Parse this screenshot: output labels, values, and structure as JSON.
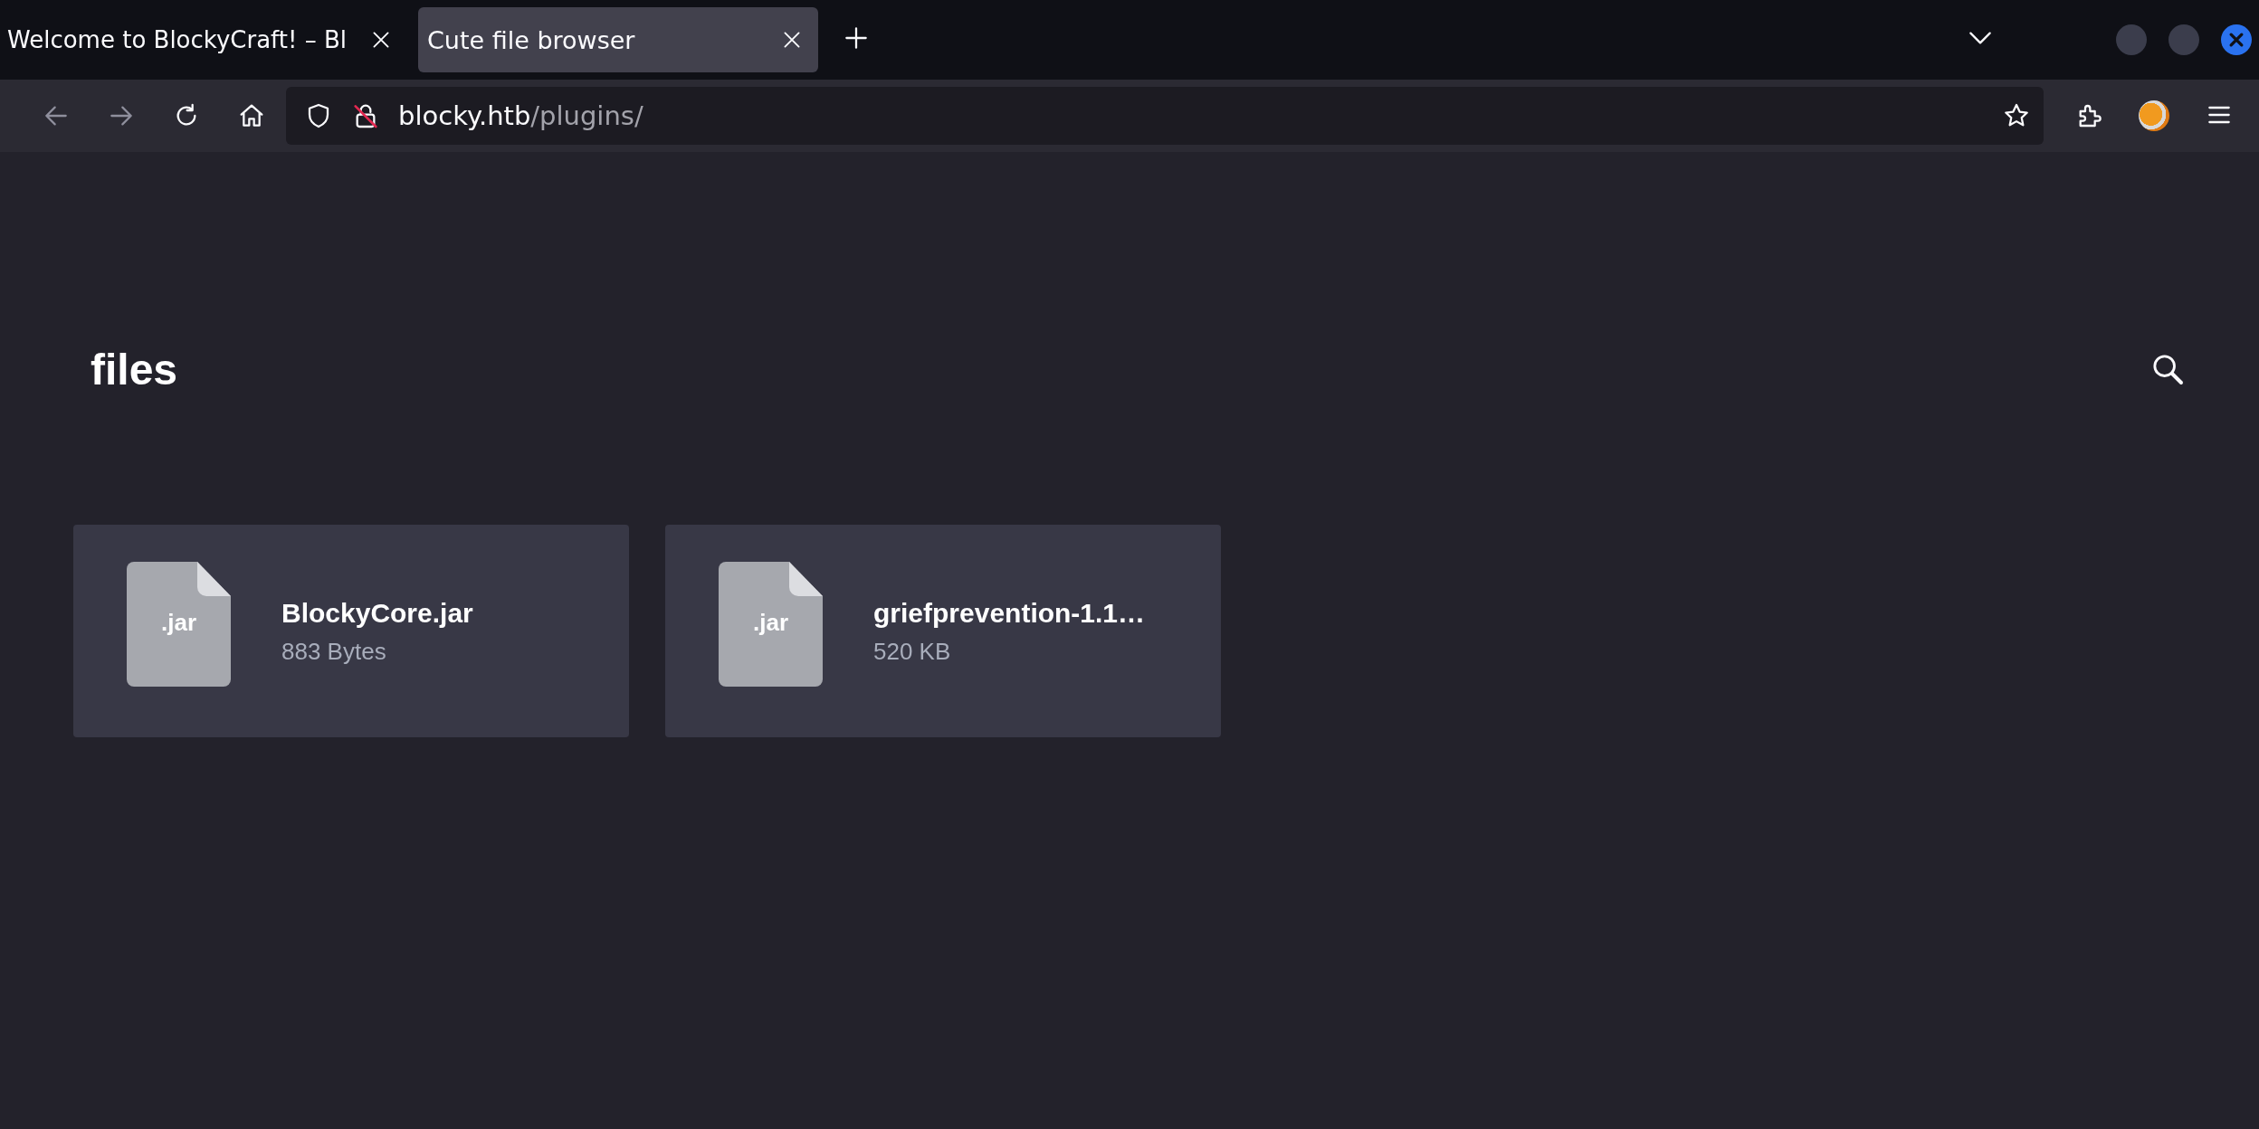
{
  "browser": {
    "tabs": [
      {
        "title": "Welcome to BlockyCraft! – Bl",
        "selected": false
      },
      {
        "title": "Cute file browser",
        "selected": true
      }
    ],
    "address": {
      "host": "blocky.htb",
      "path": "/plugins/"
    }
  },
  "page": {
    "title": "files",
    "files": [
      {
        "extension": ".jar",
        "name": "BlockyCore.jar",
        "size": "883 Bytes"
      },
      {
        "extension": ".jar",
        "name": "griefprevention-1.1…",
        "size": "520 KB"
      }
    ]
  }
}
